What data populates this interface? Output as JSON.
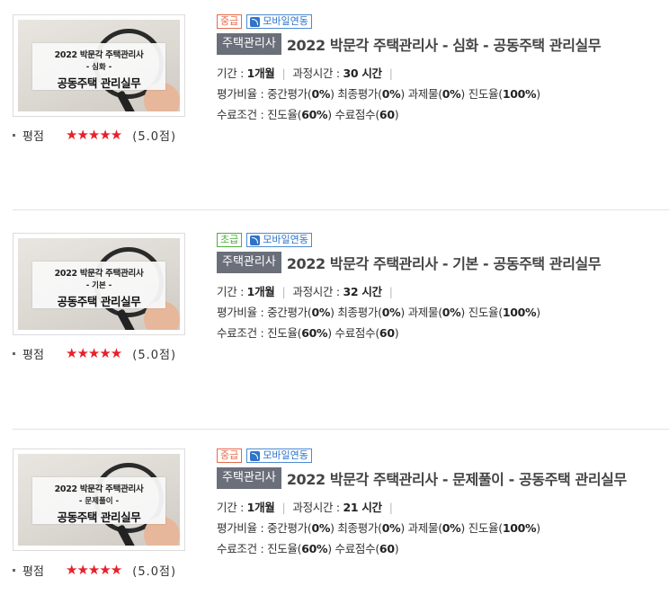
{
  "courses": [
    {
      "thumbnail": {
        "line1": "2022 박문각 주택관리사",
        "line2": "- 심화 -",
        "line3": "공동주택 관리실무"
      },
      "rating": {
        "label": "평점",
        "stars": "★★★★★",
        "score": "(5.0점)",
        "value": 5.0
      },
      "level_badge": "중급",
      "mobile_badge": "모바일연동",
      "category": "주택관리사",
      "title": "2022 박문각 주택관리사 - 심화 - 공동주택 관리실무",
      "period_label": "기간 : ",
      "period_value": "1개월",
      "hours_label": "과정시간 : ",
      "hours_value": "30 시간",
      "ratio_label": "평가비율 : ",
      "mid_label": "중간평가(",
      "mid_value": "0%",
      "final_label": ") 최종평가(",
      "final_value": "0%",
      "assign_label": ") 과제물(",
      "assign_value": "0%",
      "progress_label": ") 진도율(",
      "progress_value": "100%",
      "ratio_end": ")",
      "complete_label": "수료조건 : ",
      "cond_progress_label": "진도율(",
      "cond_progress_value": "60%",
      "cond_score_label": ") 수료점수(",
      "cond_score_value": "60",
      "cond_end": ")"
    },
    {
      "thumbnail": {
        "line1": "2022 박문각 주택관리사",
        "line2": "- 기본 -",
        "line3": "공동주택 관리실무"
      },
      "rating": {
        "label": "평점",
        "stars": "★★★★★",
        "score": "(5.0점)",
        "value": 5.0
      },
      "level_badge": "초급",
      "mobile_badge": "모바일연동",
      "category": "주택관리사",
      "title": "2022 박문각 주택관리사 - 기본 - 공동주택 관리실무",
      "period_label": "기간 : ",
      "period_value": "1개월",
      "hours_label": "과정시간 : ",
      "hours_value": "32 시간",
      "ratio_label": "평가비율 : ",
      "mid_label": "중간평가(",
      "mid_value": "0%",
      "final_label": ") 최종평가(",
      "final_value": "0%",
      "assign_label": ") 과제물(",
      "assign_value": "0%",
      "progress_label": ") 진도율(",
      "progress_value": "100%",
      "ratio_end": ")",
      "complete_label": "수료조건 : ",
      "cond_progress_label": "진도율(",
      "cond_progress_value": "60%",
      "cond_score_label": ") 수료점수(",
      "cond_score_value": "60",
      "cond_end": ")"
    },
    {
      "thumbnail": {
        "line1": "2022 박문각 주택관리사",
        "line2": "- 문제풀이 -",
        "line3": "공동주택 관리실무"
      },
      "rating": {
        "label": "평점",
        "stars": "★★★★★",
        "score": "(5.0점)",
        "value": 5.0
      },
      "level_badge": "중급",
      "mobile_badge": "모바일연동",
      "category": "주택관리사",
      "title": "2022 박문각 주택관리사 - 문제풀이 - 공동주택 관리실무",
      "period_label": "기간 : ",
      "period_value": "1개월",
      "hours_label": "과정시간 : ",
      "hours_value": "21 시간",
      "ratio_label": "평가비율 : ",
      "mid_label": "중간평가(",
      "mid_value": "0%",
      "final_label": ") 최종평가(",
      "final_value": "0%",
      "assign_label": ") 과제물(",
      "assign_value": "0%",
      "progress_label": ") 진도율(",
      "progress_value": "100%",
      "ratio_end": ")",
      "complete_label": "수료조건 : ",
      "cond_progress_label": "진도율(",
      "cond_progress_value": "60%",
      "cond_score_label": ") 수료점수(",
      "cond_score_value": "60",
      "cond_end": ")"
    }
  ],
  "colors": {
    "star": "#e8202a",
    "category_bg": "#6a6f7a",
    "mid_badge": "#e56a4a",
    "basic_badge": "#4caf3a",
    "mobile_badge": "#2b73c7"
  }
}
